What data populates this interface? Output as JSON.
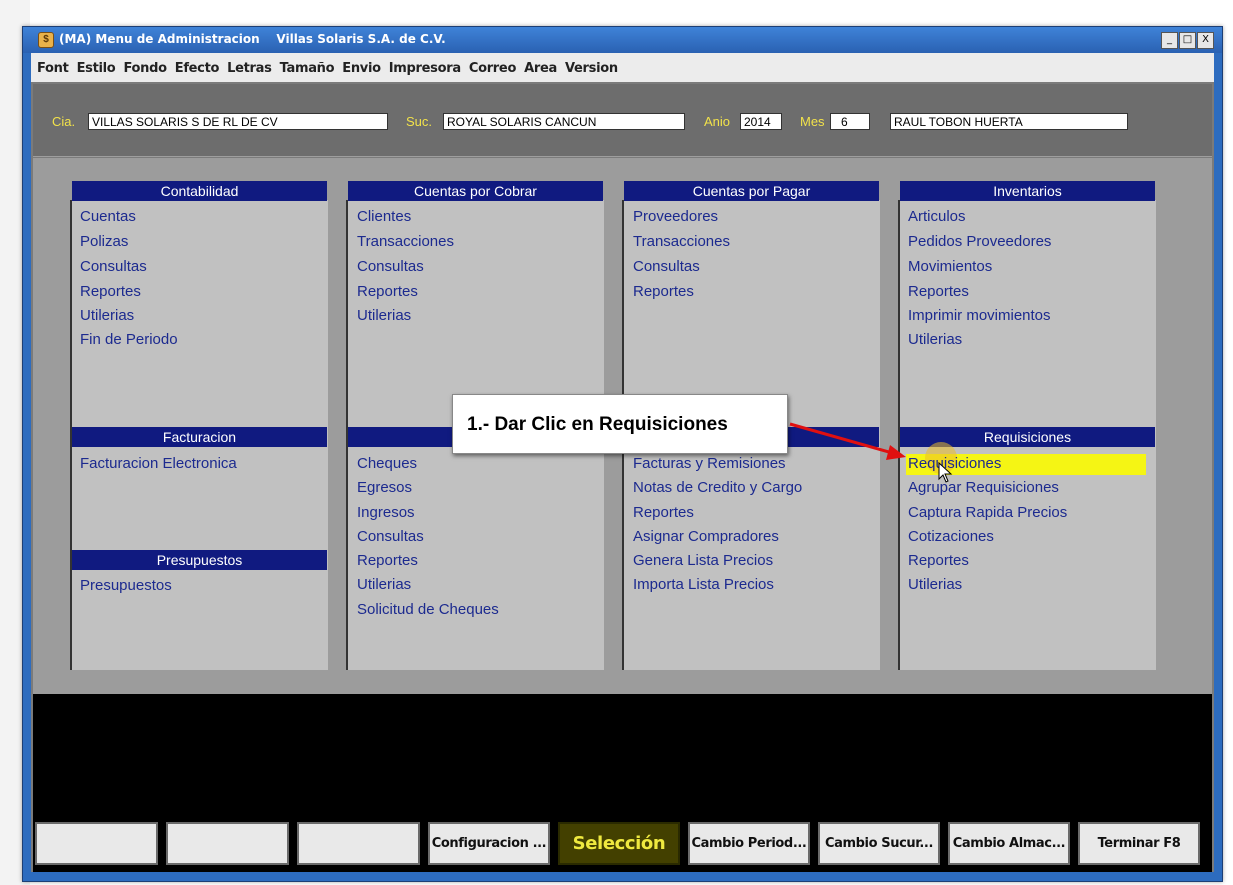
{
  "window": {
    "title": "(MA) Menu de Administracion    Villas Solaris S.A. de C.V.",
    "controls": [
      "_",
      "□",
      "X"
    ]
  },
  "menubar": [
    "Font",
    "Estilo",
    "Fondo",
    "Efecto",
    "Letras",
    "Tamaño",
    "Envio",
    "Impresora",
    "Correo",
    "Area",
    "Version"
  ],
  "header": {
    "cia_label": "Cia.",
    "cia_value": "VILLAS SOLARIS S DE RL DE CV",
    "suc_label": "Suc.",
    "suc_value": "ROYAL SOLARIS CANCUN",
    "anio_label": "Anio",
    "anio_value": "2014",
    "mes_label": "Mes",
    "mes_value": "6",
    "user_value": "RAUL TOBON HUERTA"
  },
  "sections": {
    "contabilidad": {
      "title": "Contabilidad",
      "items": [
        "Cuentas",
        "Polizas",
        "Consultas",
        "Reportes",
        "Utilerias",
        "Fin de Periodo"
      ]
    },
    "cxc": {
      "title": "Cuentas por Cobrar",
      "items": [
        "Clientes",
        "Transacciones",
        "Consultas",
        "Reportes",
        "Utilerias"
      ]
    },
    "cxp": {
      "title": "Cuentas por Pagar",
      "items": [
        "Proveedores",
        "Transacciones",
        "Consultas",
        "Reportes"
      ]
    },
    "inventarios": {
      "title": "Inventarios",
      "items": [
        "Articulos",
        "Pedidos Proveedores",
        "Movimientos",
        "Reportes",
        "Imprimir movimientos",
        "Utilerias"
      ]
    },
    "facturacion": {
      "title": "Facturacion",
      "items": [
        "Facturacion Electronica"
      ]
    },
    "tesoreria": {
      "title": "T",
      "items": [
        "Cheques",
        "Egresos",
        "Ingresos",
        "Consultas",
        "Reportes",
        "Utilerias",
        "Solicitud de Cheques"
      ]
    },
    "compras": {
      "title": "",
      "items": [
        "Facturas y Remisiones",
        "Notas de Credito y Cargo",
        "Reportes",
        "Asignar Compradores",
        "Genera Lista Precios",
        "Importa Lista Precios"
      ]
    },
    "requisiciones": {
      "title": "Requisiciones",
      "items": [
        "Requisiciones",
        "Agrupar Requisiciones",
        "Captura Rapida Precios",
        "Cotizaciones",
        "Reportes",
        "Utilerias"
      ]
    },
    "presupuestos": {
      "title": "Presupuestos",
      "items": [
        "Presupuestos"
      ]
    }
  },
  "callout": "1.- Dar Clic en Requisiciones",
  "buttons": [
    "",
    "",
    "",
    "Configuracion ...",
    "Selección",
    "Cambio Period...",
    "Cambio Sucur...",
    "Cambio Almac...",
    "Terminar F8"
  ],
  "colors": {
    "section_header": "#101a80",
    "link": "#1c2a8f",
    "label_yellow": "#f2e24a",
    "highlight": "#f5f514",
    "titlebar": "#2d6cbf",
    "arrow": "#e01010"
  }
}
